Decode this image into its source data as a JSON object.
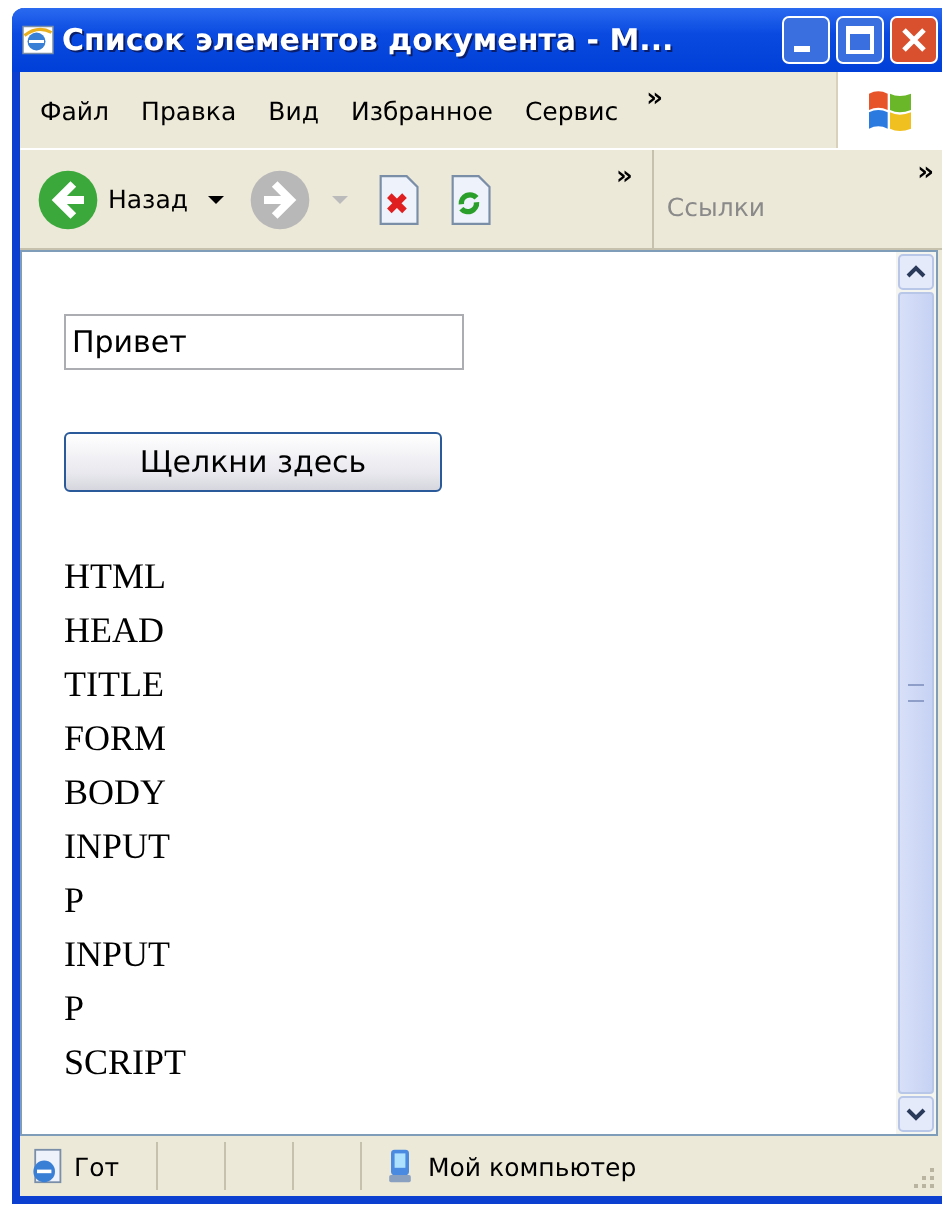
{
  "window": {
    "title": "Список элементов документа - М..."
  },
  "menu": [
    "Файл",
    "Правка",
    "Вид",
    "Избранное",
    "Сервис",
    "»"
  ],
  "toolbar": {
    "back": "Назад",
    "chevron": "»",
    "links_chevron": "»",
    "links": "Ссылки"
  },
  "page": {
    "input": {
      "value": "Привет"
    },
    "button": "Щелкни здесь",
    "elements": [
      "HTML",
      "HEAD",
      "TITLE",
      "FORM",
      "BODY",
      "INPUT",
      "P",
      "INPUT",
      "P",
      "SCRIPT"
    ]
  },
  "status_bar": {
    "text": "Гот",
    "zone": "Мой компьютер"
  }
}
